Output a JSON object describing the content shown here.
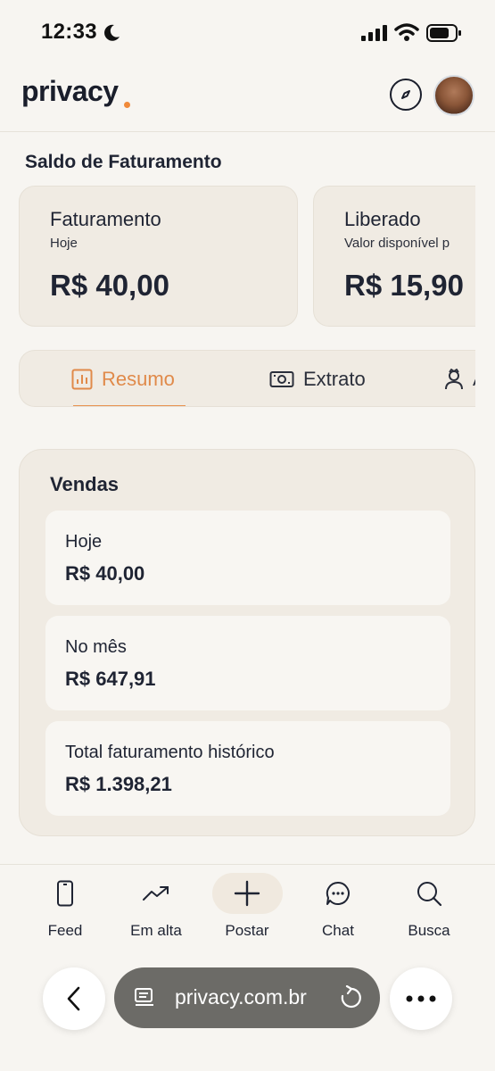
{
  "status_bar": {
    "time": "12:33"
  },
  "header": {
    "logo": "privacy",
    "accent_color": "#f08a3a"
  },
  "section_title": "Saldo de Faturamento",
  "balance_cards": [
    {
      "label": "Faturamento",
      "sub": "Hoje",
      "value": "R$ 40,00"
    },
    {
      "label": "Liberado",
      "sub": "Valor disponível p",
      "value": "R$ 15,90"
    }
  ],
  "tabs": [
    {
      "label": "Resumo",
      "icon": "chart-icon",
      "active": true
    },
    {
      "label": "Extrato",
      "icon": "money-icon",
      "active": false
    },
    {
      "label": "A",
      "icon": "person-icon",
      "active": false
    }
  ],
  "sales": {
    "title": "Vendas",
    "items": [
      {
        "label": "Hoje",
        "value": "R$ 40,00"
      },
      {
        "label": "No mês",
        "value": "R$ 647,91"
      },
      {
        "label": "Total faturamento histórico",
        "value": "R$ 1.398,21"
      }
    ]
  },
  "bottom_nav": [
    {
      "label": "Feed",
      "icon": "phone-icon"
    },
    {
      "label": "Em alta",
      "icon": "trending-icon"
    },
    {
      "label": "Postar",
      "icon": "plus-icon"
    },
    {
      "label": "Chat",
      "icon": "chat-icon"
    },
    {
      "label": "Busca",
      "icon": "search-icon"
    }
  ],
  "browser": {
    "url": "privacy.com.br"
  }
}
